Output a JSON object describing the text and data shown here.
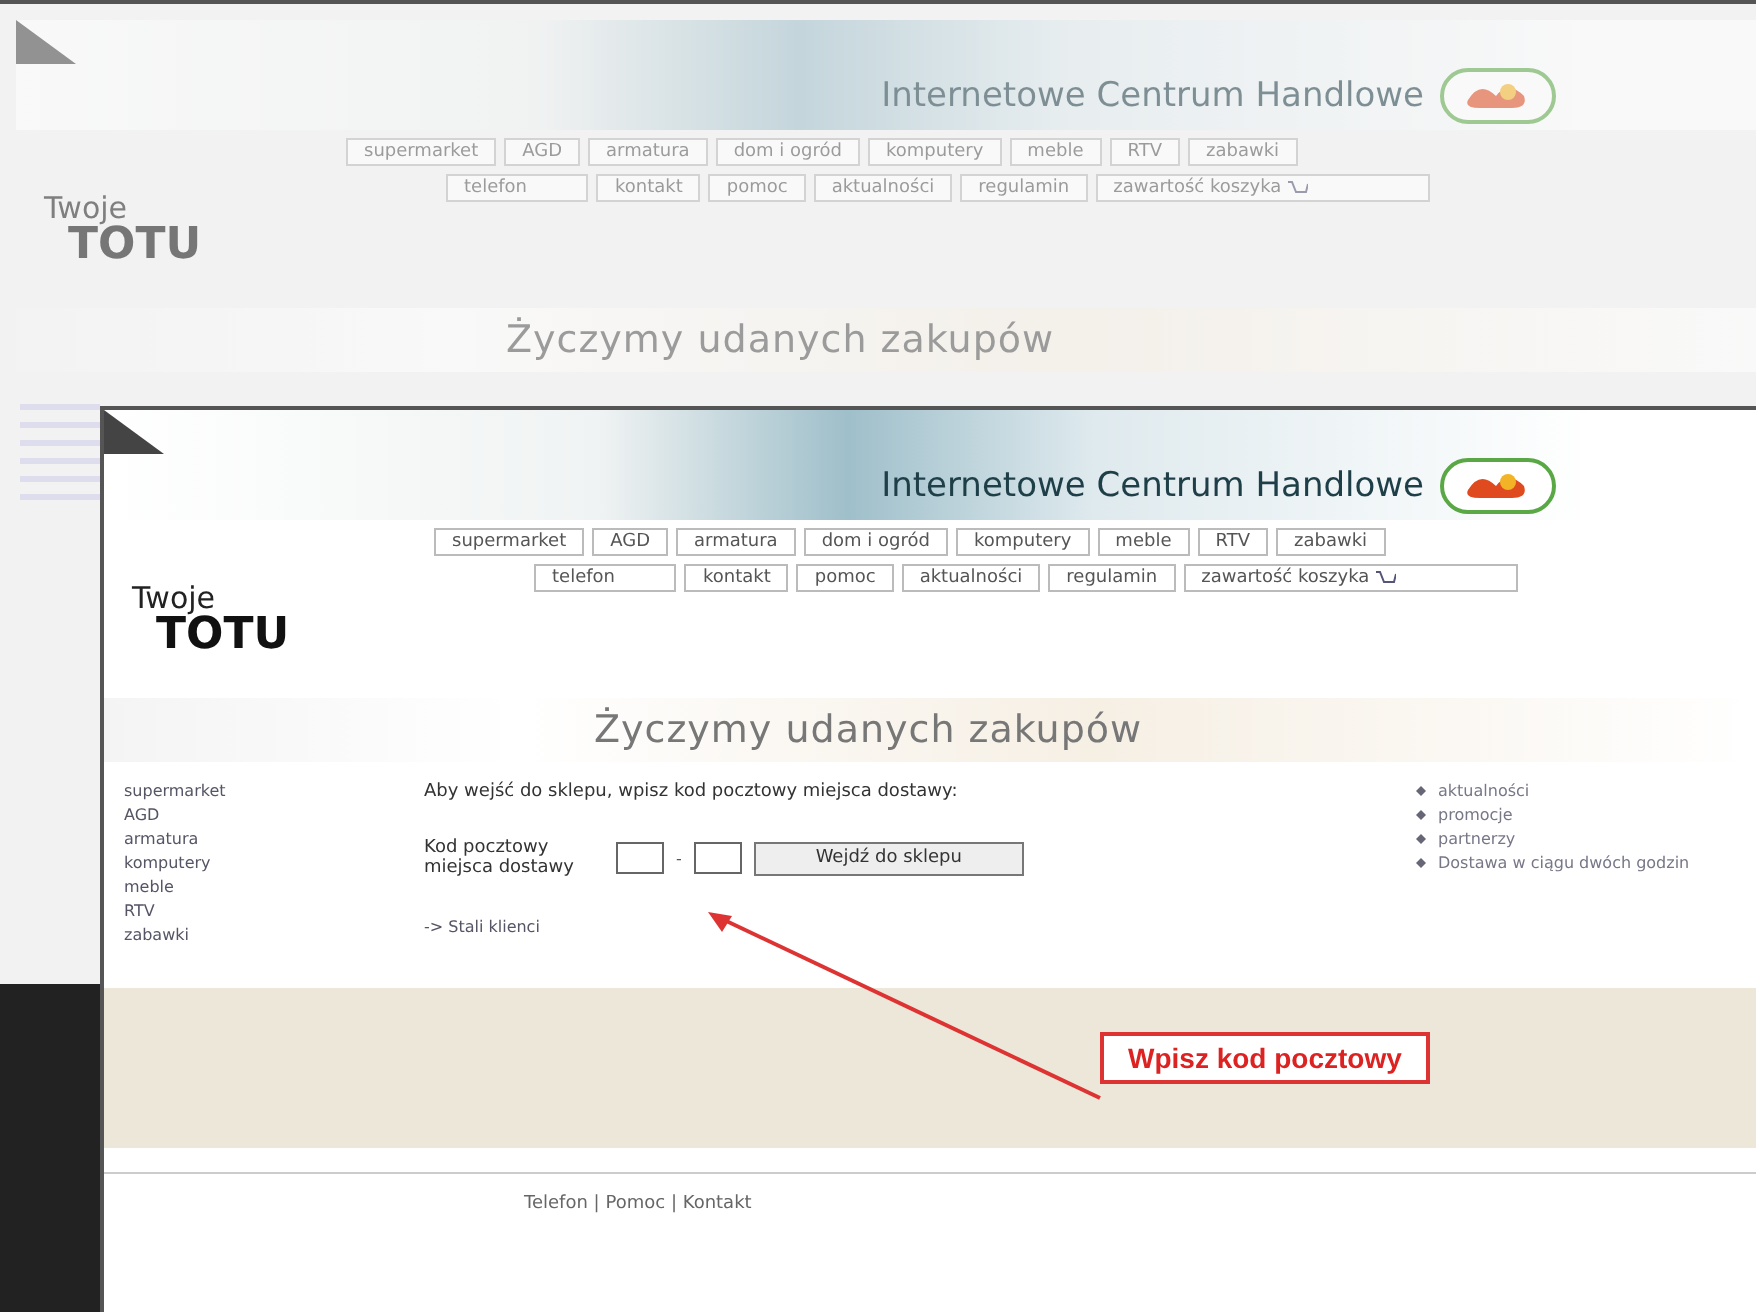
{
  "background_page": {
    "title": "Internetowe Centrum Handlowe",
    "nav_primary": [
      "supermarket",
      "AGD",
      "armatura",
      "dom i ogród",
      "komputery",
      "meble",
      "RTV",
      "zabawki"
    ],
    "nav_secondary": [
      "telefon",
      "kontakt",
      "pomoc",
      "aktualności",
      "regulamin",
      "zawartość koszyka"
    ],
    "logo": {
      "line1": "Twoje",
      "line2": "TOTU"
    },
    "slogan": "Życzymy udanych zakupów"
  },
  "page": {
    "title": "Internetowe Centrum Handlowe",
    "nav_primary": [
      "supermarket",
      "AGD",
      "armatura",
      "dom i ogród",
      "komputery",
      "meble",
      "RTV",
      "zabawki"
    ],
    "nav_secondary": [
      "telefon",
      "kontakt",
      "pomoc",
      "aktualności",
      "regulamin",
      "zawartość koszyka"
    ],
    "logo": {
      "line1": "Twoje",
      "line2": "TOTU"
    },
    "slogan": "Życzymy udanych zakupów",
    "sidebar": [
      "supermarket",
      "AGD",
      "armatura",
      "komputery",
      "meble",
      "RTV",
      "zabawki"
    ],
    "intro": "Aby wejść do sklepu, wpisz kod pocztowy miejsca dostawy:",
    "form": {
      "label": "Kod pocztowy miejsca dostawy",
      "separator": "-",
      "button": "Wejdź do sklepu"
    },
    "link": "-> Stali klienci",
    "info_links": [
      "aktualności",
      "promocje",
      "partnerzy",
      "Dostawa w ciągu dwóch godzin"
    ],
    "callout": "Wpisz kod pocztowy",
    "footer": {
      "links": [
        "Telefon",
        "Pomoc",
        "Kontakt"
      ],
      "separator": "|"
    }
  }
}
